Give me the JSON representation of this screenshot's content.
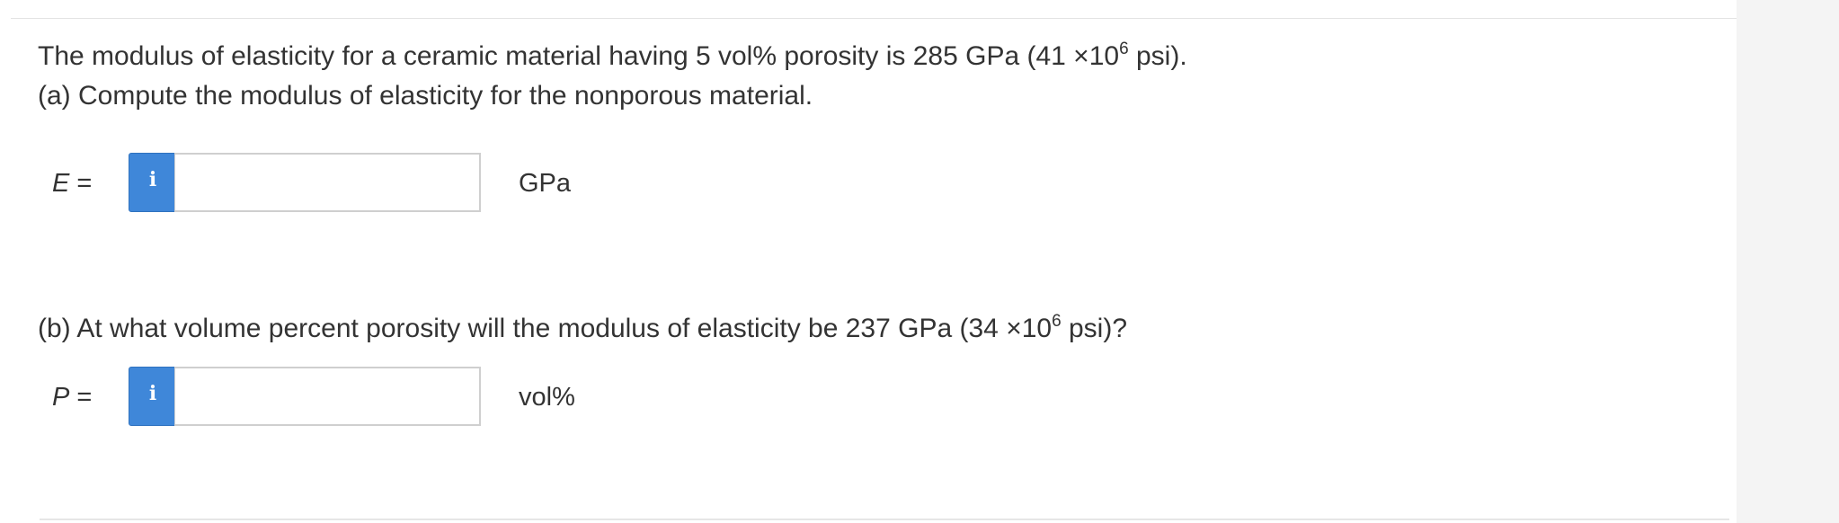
{
  "question": {
    "intro": {
      "text": "The modulus of elasticity for a ceramic material having 5 vol% porosity is 285 GPa (41 ×10",
      "exponent": "6",
      "suffix": " psi)."
    },
    "part_a": "(a) Compute the modulus of elasticity for the nonporous material.",
    "part_b": {
      "text": "(b) At what volume percent porosity will the modulus of elasticity be 237 GPa (34 ×10",
      "exponent": "6",
      "suffix": " psi)?"
    }
  },
  "answers": {
    "a": {
      "variable": "E",
      "equals": " =",
      "value": "",
      "unit": "GPa",
      "info_icon": "i"
    },
    "b": {
      "variable": "P",
      "equals": " =",
      "value": "",
      "unit": "vol%",
      "info_icon": "i"
    }
  },
  "colors": {
    "info_button": "#3f87d9",
    "text": "#333333",
    "input_border": "#cfcfcf"
  }
}
